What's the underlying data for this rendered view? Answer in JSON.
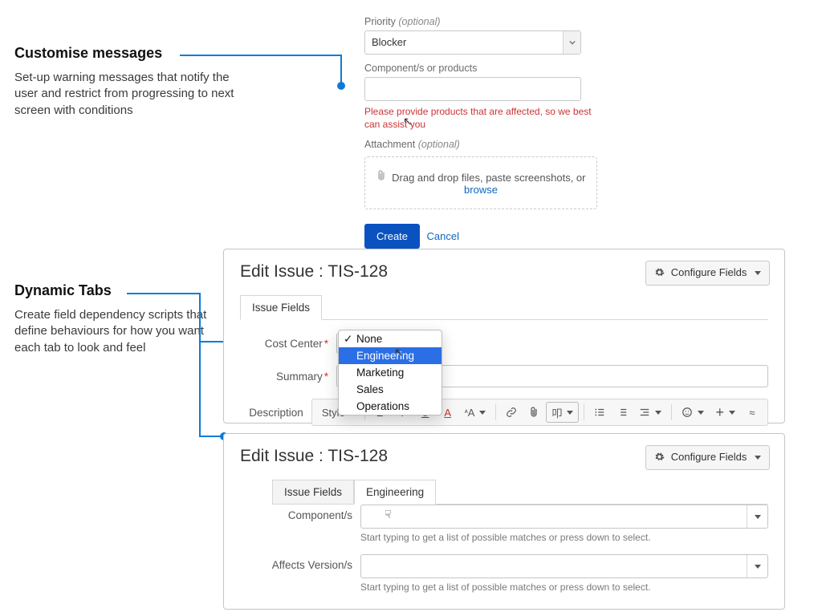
{
  "callout1": {
    "title": "Customise messages",
    "desc": "Set-up warning messages that notify the user and restrict from progressing to next screen with conditions"
  },
  "callout2": {
    "title": "Dynamic Tabs",
    "desc": "Create field dependency scripts that define behaviours for how you want each tab to look and feel"
  },
  "form": {
    "priority_label": "Priority",
    "optional": "(optional)",
    "priority_value": "Blocker",
    "components_label": "Component/s or products",
    "components_error": "Please provide products that are affected, so we best can assist you",
    "attachment_label": "Attachment",
    "dropzone_prefix": "Drag and drop files, paste screenshots, or",
    "dropzone_browse": "browse",
    "create": "Create",
    "cancel": "Cancel"
  },
  "dialog1": {
    "title": "Edit Issue : TIS-128",
    "configure": "Configure Fields",
    "tab": "Issue Fields",
    "cost_center_label": "Cost Center",
    "cost_center_required": "*",
    "summary_label": "Summary",
    "summary_required": "*",
    "description_label": "Description",
    "menu": {
      "none": "None",
      "engineering": "Engineering",
      "marketing": "Marketing",
      "sales": "Sales",
      "operations": "Operations"
    },
    "toolbar": {
      "style": "Style",
      "bold": "B",
      "italic": "I",
      "underline": "U",
      "color": "A",
      "sizeA": "A",
      "smallA": "ᴬ"
    }
  },
  "dialog2": {
    "title": "Edit Issue : TIS-128",
    "configure": "Configure Fields",
    "tab1": "Issue Fields",
    "tab2": "Engineering",
    "components_label": "Component/s",
    "affects_label": "Affects Version/s",
    "hint": "Start typing to get a list of possible matches or press down to select."
  }
}
